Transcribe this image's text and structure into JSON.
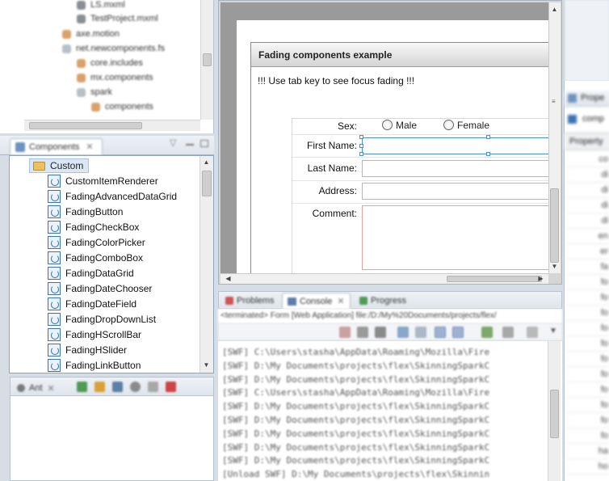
{
  "navigator": {
    "items": [
      {
        "label": "LS.mxml",
        "icon": "mxml-file-icon"
      },
      {
        "label": "TestProject.mxml",
        "icon": "mxml-file-icon"
      },
      {
        "label": "axe.motion",
        "icon": "package-icon"
      },
      {
        "label": "net.newcomponents.fs",
        "icon": "package-icon"
      },
      {
        "label": "core.includes",
        "icon": "package-icon"
      },
      {
        "label": "mx.components",
        "icon": "package-icon"
      },
      {
        "label": "spark",
        "icon": "package-icon"
      },
      {
        "label": "components",
        "icon": "package-icon"
      }
    ]
  },
  "components_view": {
    "tab_label": "Components",
    "folder_label": "Custom",
    "items": [
      "CustomItemRenderer",
      "FadingAdvancedDataGrid",
      "FadingButton",
      "FadingCheckBox",
      "FadingColorPicker",
      "FadingComboBox",
      "FadingDataGrid",
      "FadingDateChooser",
      "FadingDateField",
      "FadingDropDownList",
      "FadingHScrollBar",
      "FadingHSlider",
      "FadingLinkButton"
    ]
  },
  "ant_view": {
    "tab_label": "Ant"
  },
  "design": {
    "panel_title": "Fading components example",
    "note": "!!! Use tab key to see focus fading !!!",
    "sex_label": "Sex:",
    "radio_male": "Male",
    "radio_female": "Female",
    "first_name_label": "First Name:",
    "last_name_label": "Last Name:",
    "address_label": "Address:",
    "comment_label": "Comment:"
  },
  "console_view": {
    "tabs": [
      "Problems",
      "Console",
      "Progress"
    ],
    "status": "<terminated> Form [Web Application] file:/D:/My%20Documents/projects/flex/",
    "lines": [
      "[SWF] C:\\Users\\stasha\\AppData\\Roaming\\Mozilla\\Fire",
      "[SWF] D:\\My Documents\\projects\\flex\\SkinningSparkC",
      "[SWF] D:\\My Documents\\projects\\flex\\SkinningSparkC",
      "[SWF] C:\\Users\\stasha\\AppData\\Roaming\\Mozilla\\Fire",
      "[SWF] D:\\My Documents\\projects\\flex\\SkinningSparkC",
      "[SWF] D:\\My Documents\\projects\\flex\\SkinningSparkC",
      "[SWF] D:\\My Documents\\projects\\flex\\SkinningSparkC",
      "[SWF] D:\\My Documents\\projects\\flex\\SkinningSparkC",
      "[SWF] D:\\My Documents\\projects\\flex\\SkinningSparkC",
      "[Unload SWF] D:\\My Documents\\projects\\flex\\Skinnin"
    ]
  },
  "properties_view": {
    "tab1": "Prope",
    "tab2": "comp",
    "header": "Property",
    "rows": [
      "co",
      "di",
      "di",
      "di",
      "di",
      "en",
      "er",
      "fa",
      "fo",
      "fo",
      "fo",
      "fo",
      "fo",
      "fo",
      "fo",
      "fo",
      "fo",
      "fo",
      "fo",
      "ha",
      "ho"
    ]
  },
  "colors": {
    "accent": "#3a72b5",
    "selection": "#dbe7f6",
    "focus_border": "#4a8fd6"
  }
}
